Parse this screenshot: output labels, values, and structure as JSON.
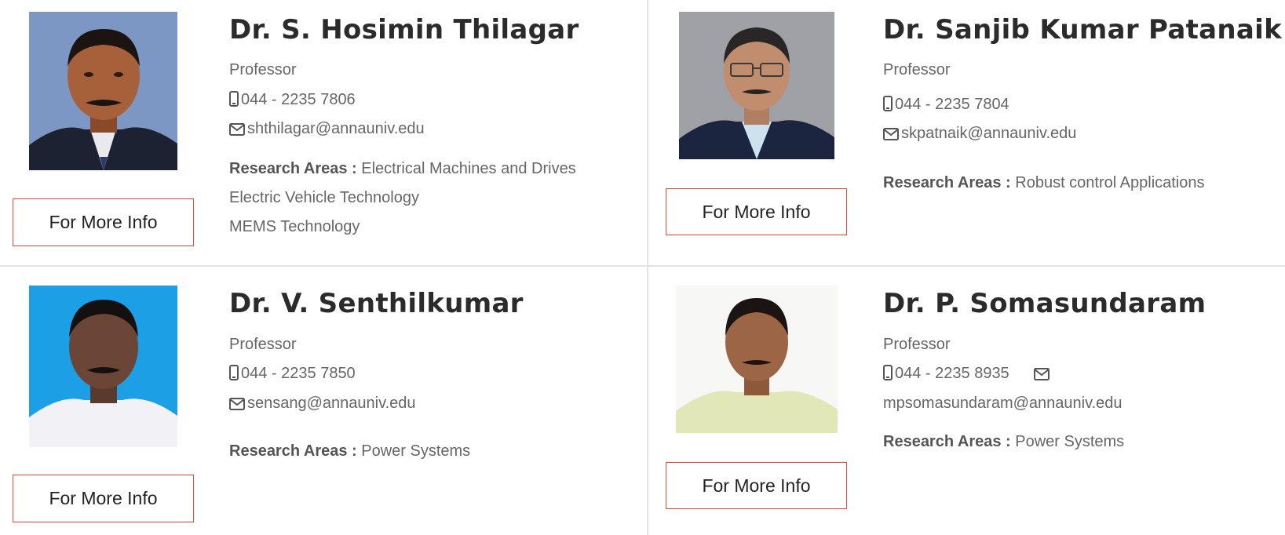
{
  "button_label": "For More Info",
  "research_label": "Research Areas :",
  "accent_color": "#e8492f",
  "faculty": [
    {
      "name": "Dr. S. Hosimin Thilagar",
      "title": "Professor",
      "phone": "044 - 2235 7806",
      "email": "shthilagar@annauniv.edu",
      "research": [
        "Electrical Machines and Drives",
        "Electric Vehicle Technology",
        "MEMS Technology"
      ]
    },
    {
      "name": "Dr. Sanjib Kumar Patanaik",
      "title": "Professor",
      "phone": "044 - 2235 7804",
      "email": "skpatnaik@annauniv.edu",
      "research": [
        "Robust control Applications"
      ]
    },
    {
      "name": "Dr. V. Senthilkumar",
      "title": "Professor",
      "phone": "044 - 2235 7850",
      "email": "sensang@annauniv.edu",
      "research": [
        "Power Systems"
      ]
    },
    {
      "name": "Dr. P. Somasundaram",
      "title": "Professor",
      "phone": "044 - 2235 8935",
      "email": "mpsomasundaram@annauniv.edu",
      "research": [
        "Power Systems"
      ]
    }
  ]
}
